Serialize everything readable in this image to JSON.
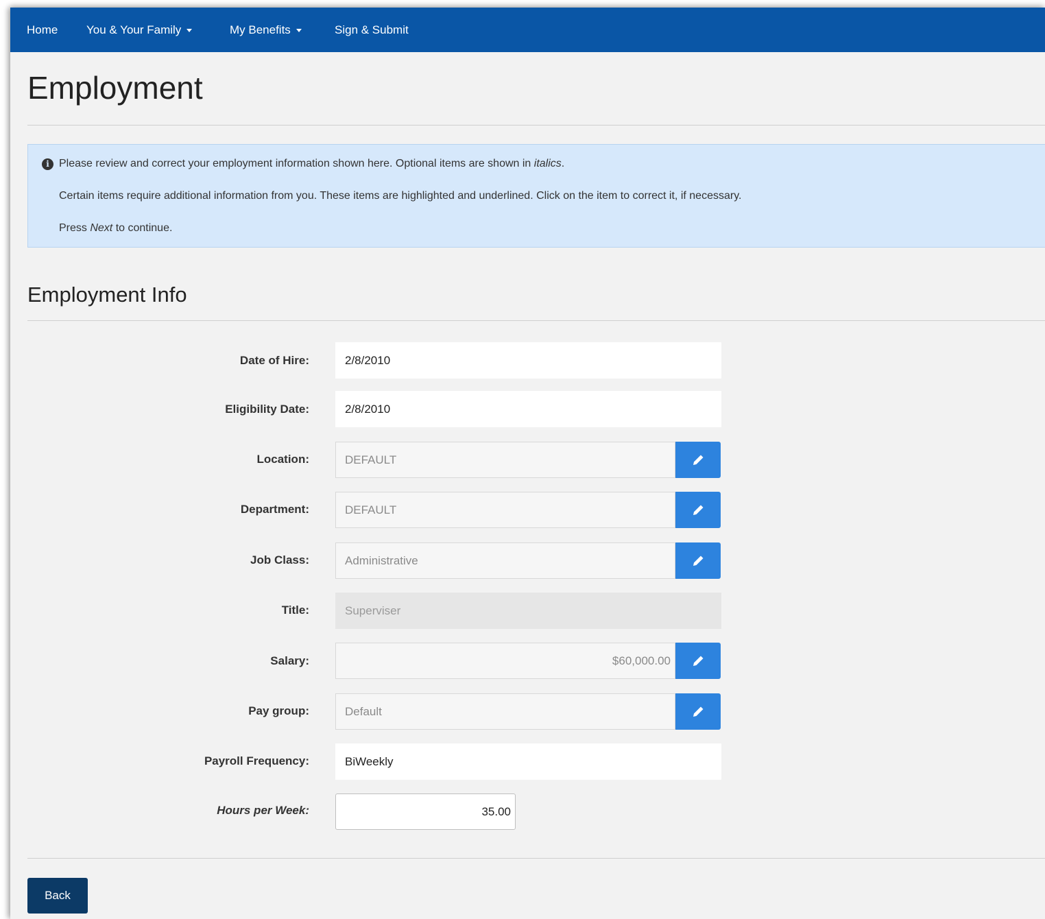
{
  "nav": {
    "home": "Home",
    "family": "You & Your Family",
    "benefits": "My Benefits",
    "sign": "Sign & Submit"
  },
  "page": {
    "title": "Employment"
  },
  "alert": {
    "line1_text": "Please review and correct your employment information shown here. Optional items are shown in ",
    "line1_italic": "italics",
    "line1_end": ".",
    "line2": "Certain items require additional information from you. These items are highlighted and underlined. Click on the item to correct it, if necessary.",
    "line3_start": "Press ",
    "line3_italic": "Next",
    "line3_end": " to continue."
  },
  "section": {
    "title": "Employment Info"
  },
  "fields": {
    "date_of_hire": {
      "label": "Date of Hire:",
      "value": "2/8/2010"
    },
    "eligibility_date": {
      "label": "Eligibility Date:",
      "value": "2/8/2010"
    },
    "location": {
      "label": "Location:",
      "value": "DEFAULT"
    },
    "department": {
      "label": "Department:",
      "value": "DEFAULT"
    },
    "job_class": {
      "label": "Job Class:",
      "value": "Administrative"
    },
    "title": {
      "label": "Title:",
      "value": "Superviser"
    },
    "salary": {
      "label": "Salary:",
      "value": "$60,000.00"
    },
    "pay_group": {
      "label": "Pay group:",
      "value": "Default"
    },
    "payroll_frequency": {
      "label": "Payroll Frequency:",
      "value": "BiWeekly"
    },
    "hours_per_week": {
      "label": "Hours per Week:",
      "value": "35.00"
    }
  },
  "actions": {
    "back": "Back"
  },
  "colors": {
    "navbar": "#0a56a6",
    "alert_bg": "#d6e8fb",
    "edit_button": "#2d83de",
    "back_button": "#0c3a66"
  },
  "icons": {
    "edit": "pencil-icon",
    "info": "info-circle-icon",
    "dropdown": "caret-down-icon"
  }
}
